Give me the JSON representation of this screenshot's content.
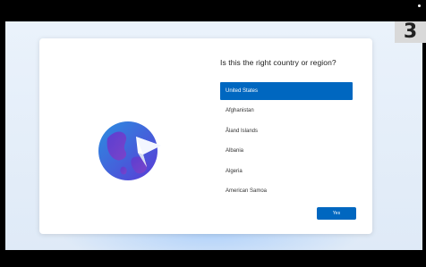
{
  "setup": {
    "question": "Is this the right country or region?",
    "countries": [
      {
        "label": "United States",
        "selected": true
      },
      {
        "label": "Afghanistan",
        "selected": false
      },
      {
        "label": "Åland Islands",
        "selected": false
      },
      {
        "label": "Albania",
        "selected": false
      },
      {
        "label": "Algeria",
        "selected": false
      },
      {
        "label": "American Samoa",
        "selected": false
      }
    ],
    "yes_label": "Yes"
  },
  "step_badge": "3",
  "tray": {
    "accessibility_icon": "accessibility-icon",
    "volume_icon": "volume-icon"
  },
  "colors": {
    "accent": "#0067c0",
    "card_background": "#ffffff",
    "desktop_background": "#e6eef8",
    "frame": "#000000",
    "badge": "#d9d9d9"
  }
}
